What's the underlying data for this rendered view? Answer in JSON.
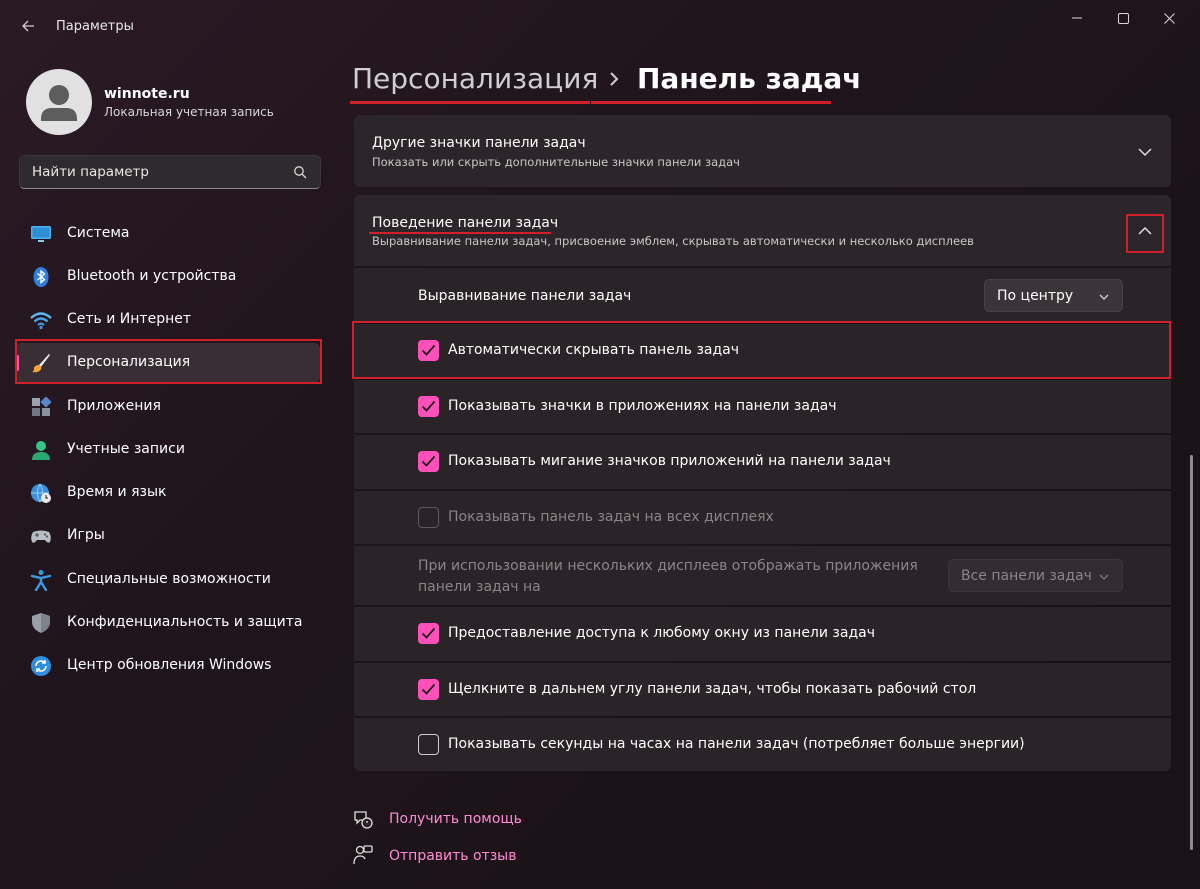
{
  "window": {
    "title": "Параметры"
  },
  "profile": {
    "name": "winnote.ru",
    "account_type": "Локальная учетная запись"
  },
  "search": {
    "placeholder": "Найти параметр"
  },
  "sidebar": {
    "items": [
      {
        "label": "Система",
        "icon": "monitor-icon"
      },
      {
        "label": "Bluetooth и устройства",
        "icon": "bluetooth-icon"
      },
      {
        "label": "Сеть и Интернет",
        "icon": "wifi-icon"
      },
      {
        "label": "Персонализация",
        "icon": "paintbrush-icon",
        "active": true
      },
      {
        "label": "Приложения",
        "icon": "apps-icon"
      },
      {
        "label": "Учетные записи",
        "icon": "person-icon"
      },
      {
        "label": "Время и язык",
        "icon": "globe-clock-icon"
      },
      {
        "label": "Игры",
        "icon": "gamepad-icon"
      },
      {
        "label": "Специальные возможности",
        "icon": "accessibility-icon"
      },
      {
        "label": "Конфиденциальность и защита",
        "icon": "shield-icon"
      },
      {
        "label": "Центр обновления Windows",
        "icon": "update-icon"
      }
    ]
  },
  "breadcrumb": {
    "parent": "Персонализация",
    "current": "Панель задач"
  },
  "sections": {
    "other_icons": {
      "title": "Другие значки панели задач",
      "subtitle": "Показать или скрыть дополнительные значки панели задач"
    },
    "behavior": {
      "title": "Поведение панели задач",
      "subtitle": "Выравнивание панели задач, присвоение эмблем, скрывать автоматически и несколько дисплеев"
    }
  },
  "settings": {
    "alignment_label": "Выравнивание панели задач",
    "alignment_value": "По центру",
    "auto_hide": {
      "label": "Автоматически скрывать панель задач",
      "checked": true
    },
    "show_badges": {
      "label": "Показывать значки в приложениях на панели задач",
      "checked": true
    },
    "show_flashing": {
      "label": "Показывать мигание значков приложений на панели задач",
      "checked": true
    },
    "all_displays": {
      "label": "Показывать панель задач на всех дисплеях",
      "checked": false,
      "disabled": true
    },
    "multi_display_label_line1": "При использовании нескольких дисплеев отображать приложения",
    "multi_display_label_line2": "панели задач на",
    "multi_display_value": "Все панели задач",
    "share_window": {
      "label": "Предоставление доступа к любому окну из панели задач",
      "checked": true
    },
    "far_corner": {
      "label": "Щелкните в дальнем углу панели задач, чтобы показать рабочий стол",
      "checked": true
    },
    "show_seconds": {
      "label": "Показывать секунды на часах на панели задач (потребляет больше энергии)",
      "checked": false
    }
  },
  "footer": {
    "help": "Получить помощь",
    "feedback": "Отправить отзыв"
  },
  "colors": {
    "accent": "#ff4fb8",
    "highlight": "#d0202c",
    "link": "#ff8ad6"
  }
}
